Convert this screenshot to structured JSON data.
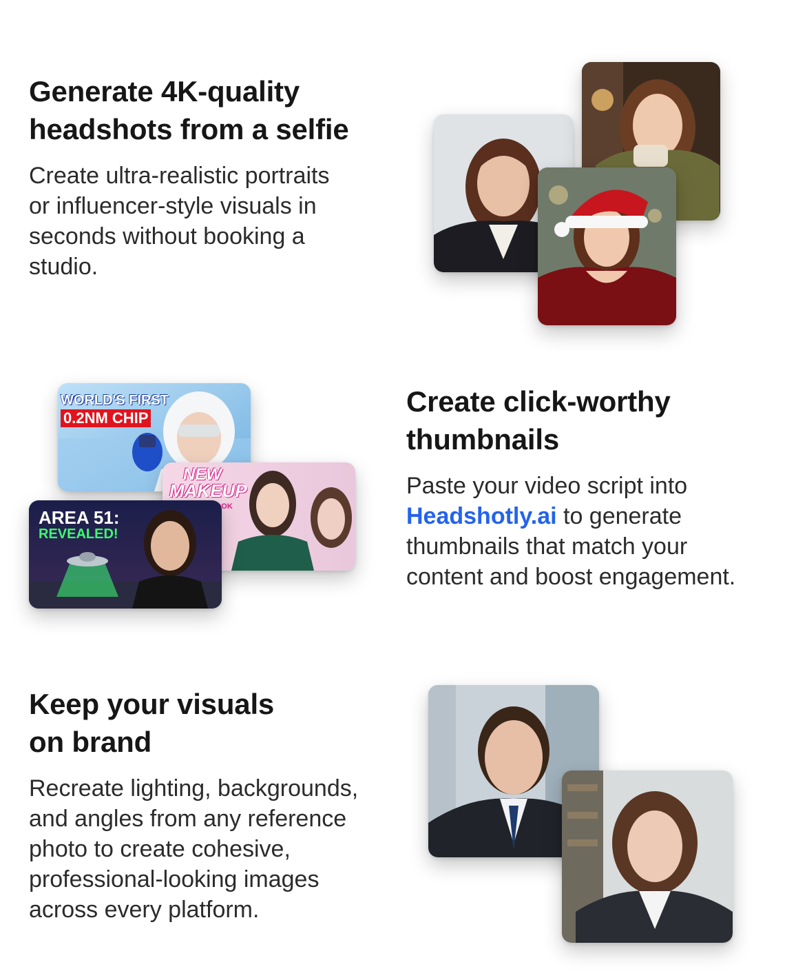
{
  "features": [
    {
      "heading_line1": "Generate 4K-quality",
      "heading_line2": "headshots from a selfie",
      "description": [
        "Create ultra-realistic portraits",
        "or influencer-style visuals in",
        "seconds without booking a",
        "studio."
      ]
    },
    {
      "heading_line1": "Create click-worthy",
      "heading_line2": "thumbnails",
      "description_before_link": "Paste your video script into",
      "link_text": "Headshotly.ai",
      "description_after_link": " to generate",
      "description_rest": [
        "thumbnails that match your",
        "content and boost engagement."
      ]
    },
    {
      "heading_line1": "Keep your visuals",
      "heading_line2": "on brand",
      "description": [
        "Recreate lighting, backgrounds,",
        "and angles from any reference",
        "photo to create cohesive,",
        "professional-looking images",
        "across every platform."
      ]
    }
  ],
  "thumbnails": {
    "chip_line1": "WORLD'S FIRST",
    "chip_line2": "0.2NM CHIP",
    "makeup_line1": "NEW",
    "makeup_line2": "MAKEUP",
    "makeup_line3": "LOOK",
    "area_line1": "AREA 51:",
    "area_line2": "REVEALED!"
  },
  "colors": {
    "link": "#2463eb",
    "heading": "#161616",
    "body": "#2b2b2b"
  }
}
